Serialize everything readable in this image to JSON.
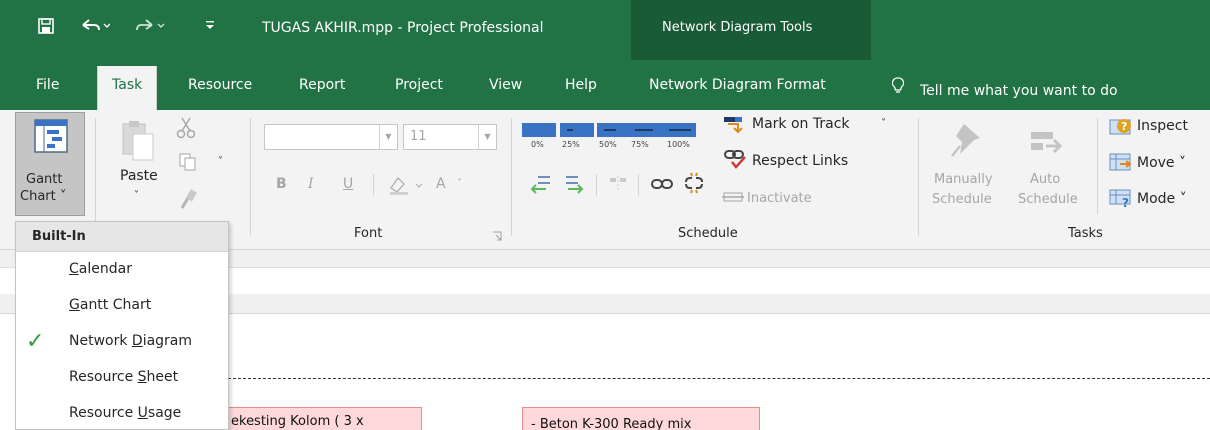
{
  "titlebar": {
    "title": "TUGAS AKHIR.mpp  -  Project Professional",
    "tools_label": "Network Diagram Tools"
  },
  "tabs": [
    {
      "label": "File",
      "active": false
    },
    {
      "label": "Task",
      "active": true
    },
    {
      "label": "Resource",
      "active": false
    },
    {
      "label": "Report",
      "active": false
    },
    {
      "label": "Project",
      "active": false
    },
    {
      "label": "View",
      "active": false
    },
    {
      "label": "Help",
      "active": false
    },
    {
      "label": "Network Diagram Format",
      "active": false
    }
  ],
  "tellme": "Tell me what you want to do",
  "ribbon": {
    "gantt_chart": {
      "line1": "Gantt",
      "line2": "Chart ˅"
    },
    "paste": "Paste",
    "font": {
      "size": "11",
      "bold": "B",
      "italic": "I",
      "underline": "U",
      "font_color": "A",
      "group_label": "Font"
    },
    "schedule": {
      "percents": [
        "0%",
        "25%",
        "50%",
        "75%",
        "100%"
      ],
      "mark_on_track": "Mark on Track",
      "respect_links": "Respect Links",
      "inactivate": "Inactivate",
      "group_label": "Schedule"
    },
    "tasks": {
      "manually": {
        "line1": "Manually",
        "line2": "Schedule"
      },
      "auto": {
        "line1": "Auto",
        "line2": "Schedule"
      },
      "inspect": "Inspect",
      "move": "Move ˅",
      "mode": "Mode ˅",
      "group_label": "Tasks"
    }
  },
  "dropdown": {
    "header": "Built-In",
    "items": [
      {
        "prefix": "",
        "accel": "C",
        "rest": "alendar",
        "checked": false
      },
      {
        "prefix": "",
        "accel": "G",
        "rest": "antt Chart",
        "checked": false
      },
      {
        "prefix": "Network ",
        "accel": "D",
        "rest": "iagram",
        "checked": true
      },
      {
        "prefix": "Resource ",
        "accel": "S",
        "rest": "heet",
        "checked": false
      },
      {
        "prefix": "Resource ",
        "accel": "U",
        "rest": "sage",
        "checked": false
      }
    ]
  },
  "diagram": {
    "task1": "ekesting Kolom ( 3 x",
    "task2": "- Beton K-300 Ready mix"
  },
  "colors": {
    "accent": "#217346",
    "contextual": "#195a37",
    "task_fill": "#ffd9d9",
    "task_border": "#e88a8a",
    "check": "#3a9a3a"
  },
  "icons": [
    "save-icon",
    "undo-icon",
    "redo-icon",
    "customize-qat-icon",
    "lightbulb-icon",
    "gantt-chart-icon",
    "paste-icon",
    "cut-icon",
    "copy-icon",
    "format-painter-icon",
    "mark-on-track-icon",
    "respect-links-icon",
    "inactivate-icon",
    "manually-schedule-icon",
    "auto-schedule-icon",
    "inspect-icon",
    "move-icon",
    "mode-icon",
    "checkmark-icon"
  ]
}
